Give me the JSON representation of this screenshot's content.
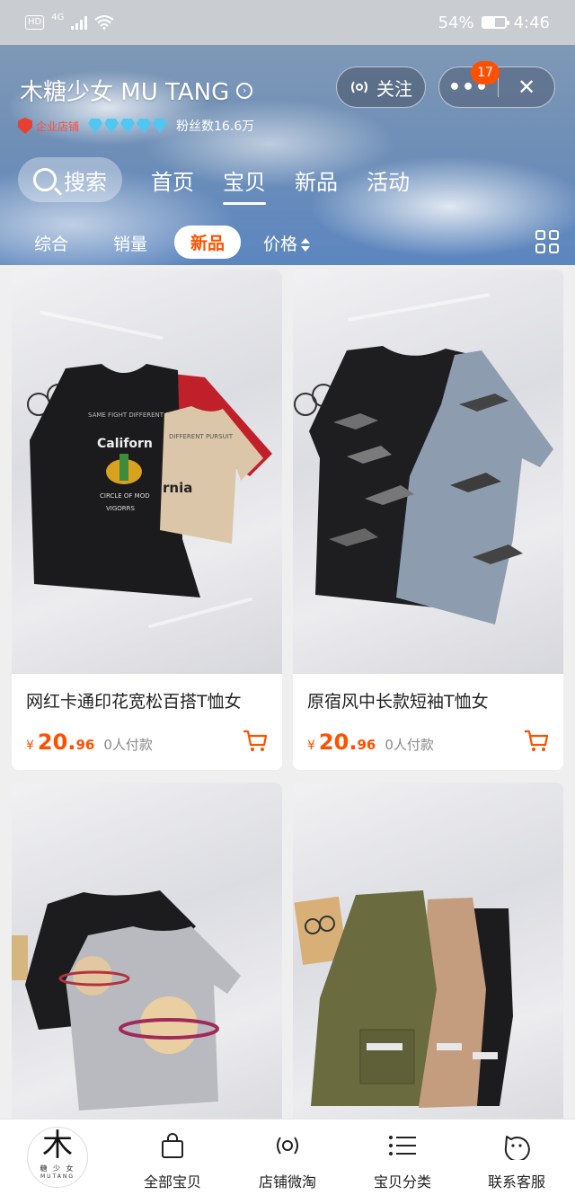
{
  "status_bar": {
    "hd": "HD",
    "network": "4G",
    "battery": "54%",
    "battery_level": 0.54,
    "time": "4:46"
  },
  "shop": {
    "name": "木糖少女 MU TANG",
    "enterprise_badge": "企业店铺",
    "diamond_level": 5,
    "fans": "粉丝数16.6万",
    "follow_label": "关注",
    "more_label": "•••",
    "notification_count": "17",
    "close_label": "✕"
  },
  "nav": {
    "search_label": "搜索",
    "tabs": [
      "首页",
      "宝贝",
      "新品",
      "活动"
    ],
    "active_tab": "宝贝"
  },
  "filters": {
    "items": [
      "综合",
      "销量",
      "新品",
      "价格"
    ],
    "active": "新品"
  },
  "products": [
    {
      "title": "网红卡通印花宽松百搭T恤女",
      "currency": "¥",
      "price_int": "20.",
      "price_dec": "96",
      "sold": "0人付款"
    },
    {
      "title": "原宿风中长款短袖T恤女",
      "currency": "¥",
      "price_int": "20.",
      "price_dec": "96",
      "sold": "0人付款"
    },
    {
      "title": "",
      "currency": "",
      "price_int": "",
      "price_dec": "",
      "sold": ""
    },
    {
      "title": "",
      "currency": "",
      "price_int": "",
      "price_dec": "",
      "sold": ""
    }
  ],
  "bottom_nav": {
    "logo_char": "木",
    "logo_sub": "糖 少 女",
    "logo_tiny": "MUTANG",
    "items": [
      "全部宝贝",
      "店铺微淘",
      "宝贝分类",
      "联系客服"
    ]
  },
  "colors": {
    "accent": "#ff5000",
    "sky": "#6f8fb7"
  }
}
